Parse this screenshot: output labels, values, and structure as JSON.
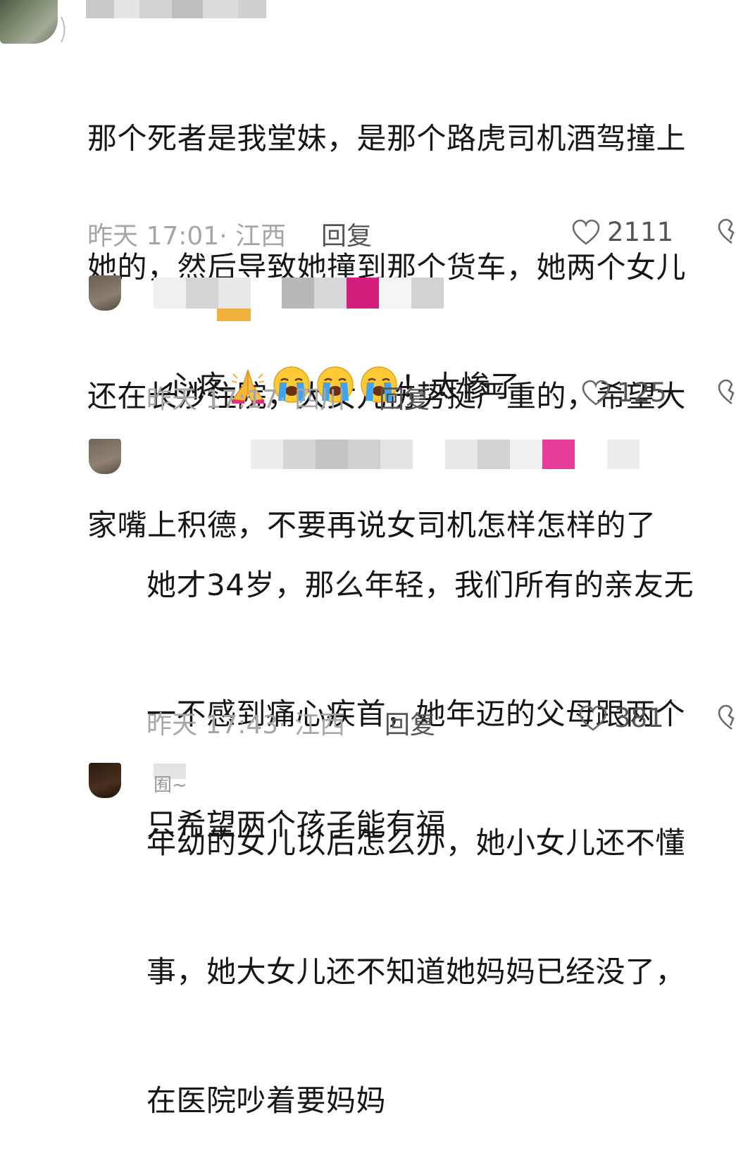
{
  "comments": [
    {
      "text": "那个死者是我堂妹，是那个路虎司机酒驾撞上她的，然后导致她撞到那个货车，她两个女儿还在长沙住院，大女儿伤势挺严重的，希望大家嘴上积德，不要再说女司机怎样怎样的了",
      "lines": [
        "那个死者是我堂妹，是那个路虎司机酒驾撞上",
        "她的，然后导致她撞到那个货车，她两个女儿",
        "还在长沙住院，大女儿伤势挺严重的，希望大",
        "家嘴上积德，不要再说女司机怎样怎样的了"
      ],
      "time_location": "昨天 17:01· 江西",
      "reply_label": "回复",
      "likes": "2111"
    },
    {
      "text_before": "心疼",
      "text_after": "！太惨了",
      "emojis": [
        "folded-hands",
        "loudly-crying-face",
        "loudly-crying-face",
        "loudly-crying-face"
      ],
      "time_location": "昨天 17:17· 四川",
      "reply_label": "回复",
      "likes": "125"
    },
    {
      "text": "她才34岁，那么年轻，我们所有的亲友无一不感到痛心疾首，她年迈的父母跟两个年幼的女儿以后怎么办，她小女儿还不懂事，她大女儿还不知道她妈妈已经没了，在医院吵着要妈妈",
      "lines": [
        "她才34岁，那么年轻，我们所有的亲友无",
        "一不感到痛心疾首，她年迈的父母跟两个",
        "年幼的女儿以后怎么办，她小女儿还不懂",
        "事，她大女儿还不知道她妈妈已经没了，",
        "在医院吵着要妈妈"
      ],
      "time_location": "昨天 17:43· 江西",
      "reply_label": "回复",
      "likes": "381"
    },
    {
      "username_fragment": "囿~",
      "text": "只希望两个孩子能有福"
    }
  ],
  "colors": {
    "text": "#161616",
    "meta": "#a6a6a6",
    "reply": "#555555",
    "mosaic_pink": "#d41f7a",
    "mosaic_orange": "#f0b23c"
  },
  "icons": {
    "like": "heart-outline-icon",
    "dislike": "broken-heart-outline-icon"
  }
}
